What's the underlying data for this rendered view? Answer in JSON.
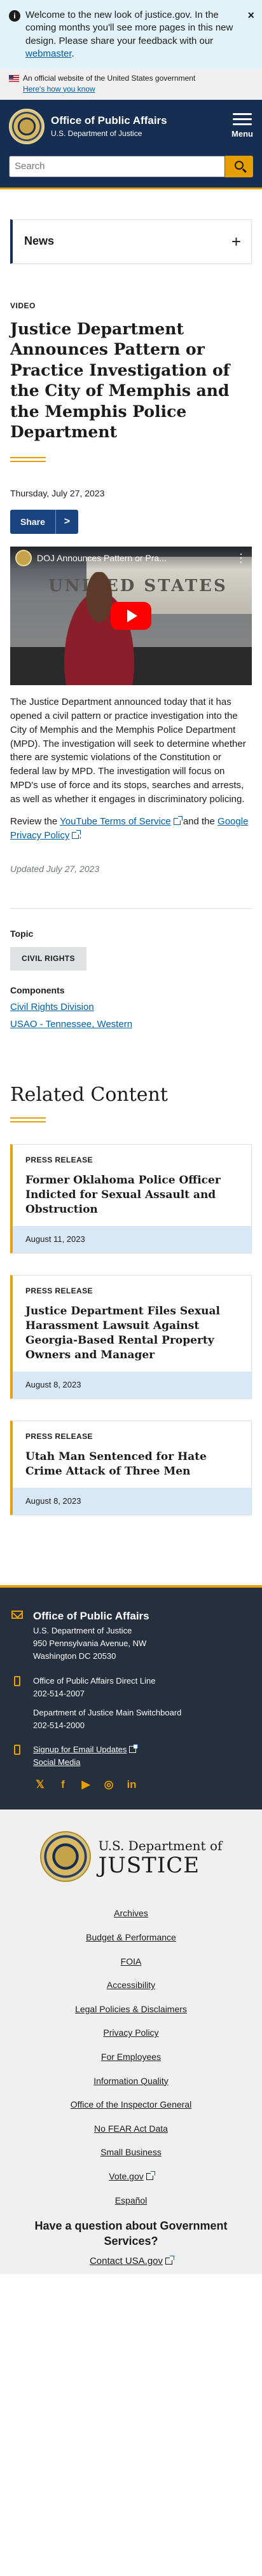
{
  "notice": {
    "text": "Welcome to the new look of justice.gov. In the coming months you'll see more pages in this new design. Please share your feedback with our ",
    "link": "webmaster",
    "suffix": ".",
    "close": "×"
  },
  "gov_banner": {
    "text": "An official website of the United States government",
    "toggle": "Here's how you know"
  },
  "header": {
    "title": "Office of Public Affairs",
    "subtitle": "U.S. Department of Justice",
    "menu_label": "Menu",
    "search_placeholder": "Search"
  },
  "news_accordion": {
    "label": "News",
    "icon": "+"
  },
  "article": {
    "kicker": "VIDEO",
    "title": "Justice Department Announces Pattern or Practice Investigation of the City of Memphis and the Memphis Police Department",
    "date": "Thursday, July 27, 2023",
    "share_label": "Share",
    "share_arrow": ">",
    "video_title": "DOJ Announces Pattern or Pra...",
    "video_sign": "UNITED STATES",
    "body": "The Justice Department announced today that it has opened a civil pattern or practice investigation into the City of Memphis and the Memphis Police Department (MPD). The investigation will seek to determine whether there are systemic violations of the Constitution or federal law by MPD. The investigation will focus on MPD's use of force and its stops, searches and arrests, as well as whether it engages in discriminatory policing.",
    "review_prefix": "Review the ",
    "review_link1": "YouTube Terms of Service",
    "review_mid": " and the ",
    "review_link2": "Google Privacy Policy",
    "review_suffix": ".",
    "updated": "Updated July 27, 2023"
  },
  "meta": {
    "topic_heading": "Topic",
    "topic": "CIVIL RIGHTS",
    "components_heading": "Components",
    "components": [
      "Civil Rights Division",
      "USAO - Tennessee, Western"
    ]
  },
  "related": {
    "heading": "Related Content",
    "cards": [
      {
        "type": "PRESS RELEASE",
        "title": "Former Oklahoma Police Officer Indicted for Sexual Assault and Obstruction",
        "date": "August 11, 2023"
      },
      {
        "type": "PRESS RELEASE",
        "title": "Justice Department Files Sexual Harassment Lawsuit Against Georgia-Based Rental Property Owners and Manager",
        "date": "August 8, 2023"
      },
      {
        "type": "PRESS RELEASE",
        "title": "Utah Man Sentenced for Hate Crime Attack of Three Men",
        "date": "August 8, 2023"
      }
    ]
  },
  "footer": {
    "office": "Office of Public Affairs",
    "address": [
      "U.S. Department of Justice",
      "950 Pennsylvania Avenue, NW",
      "Washington DC 20530"
    ],
    "direct_line_label": "Office of Public Affairs Direct Line",
    "direct_line": "202-514-2007",
    "switchboard_label": "Department of Justice Main Switchboard",
    "switchboard": "202-514-2000",
    "signup": "Signup for Email Updates",
    "social_media": "Social Media",
    "logo_line1": "U.S. Department of",
    "logo_line2": "JUSTICE",
    "links": [
      "Archives",
      "Budget & Performance",
      "FOIA",
      "Accessibility",
      "Legal Policies & Disclaimers",
      "Privacy Policy",
      "For Employees",
      "Information Quality",
      "Office of the Inspector General",
      "No FEAR Act Data",
      "Small Business",
      "Vote.gov",
      "Español"
    ],
    "question": "Have a question about Government Services?",
    "contact": "Contact USA.gov"
  }
}
